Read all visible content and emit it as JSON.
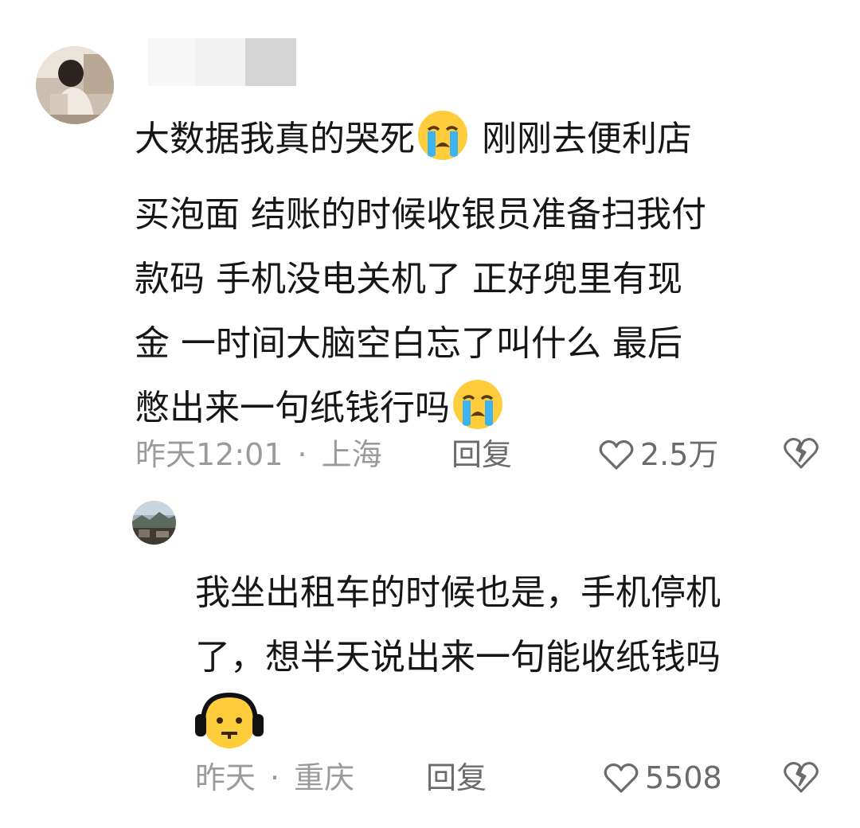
{
  "comments": [
    {
      "username": "",
      "text_lines": [
        "大数据我真的哭死",
        "买泡面 结账的时候收银员准备扫我付",
        "款码 手机没电关机了 正好兜里有现",
        "金 一时间大脑空白忘了叫什么 最后",
        "憋出来一句纸钱行吗"
      ],
      "line1_after_emoji": "刚刚去便利店",
      "emoji": "loudly-crying-face",
      "time": "昨天12:01",
      "location": "上海",
      "reply_label": "回复",
      "likes": "2.5万"
    },
    {
      "text_lines": [
        "我坐出租车的时候也是，手机停机",
        "了，想半天说出来一句能收纸钱吗"
      ],
      "emoji": "face-with-headphones",
      "time": "昨天",
      "location": "重庆",
      "reply_label": "回复",
      "likes": "5508"
    }
  ],
  "separator": "·",
  "colors": {
    "text": "#161616",
    "meta": "#9a9a9a",
    "action": "#6b6b6b"
  }
}
